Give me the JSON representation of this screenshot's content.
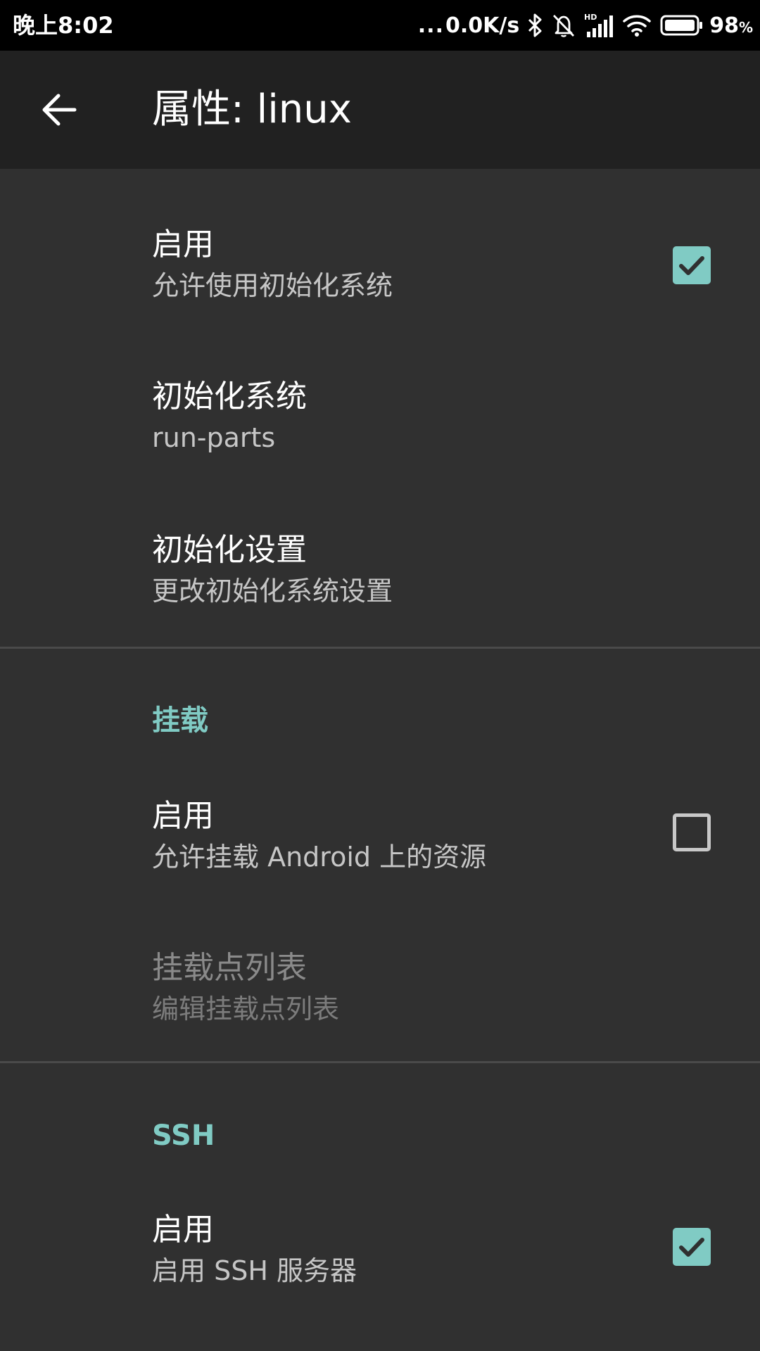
{
  "status_bar": {
    "time": "晚上8:02",
    "dots": "...",
    "network_speed": "0.0K/s",
    "battery_percent": "98",
    "battery_unit": "%"
  },
  "toolbar": {
    "title": "属性: linux"
  },
  "init": {
    "enable_title": "启用",
    "enable_summary": "允许使用初始化系统",
    "enable_checked": true,
    "system_title": "初始化系统",
    "system_value": "run-parts",
    "settings_title": "初始化设置",
    "settings_summary": "更改初始化系统设置"
  },
  "mount": {
    "header": "挂载",
    "enable_title": "启用",
    "enable_summary": "允许挂载 Android 上的资源",
    "enable_checked": false,
    "list_title": "挂载点列表",
    "list_summary": "编辑挂载点列表"
  },
  "ssh": {
    "header": "SSH",
    "enable_title": "启用",
    "enable_summary": "启用 SSH 服务器",
    "enable_checked": true
  },
  "colors": {
    "accent": "#80cbc4",
    "toolbar": "#212121",
    "background": "#303030",
    "status_bar": "#000000"
  }
}
